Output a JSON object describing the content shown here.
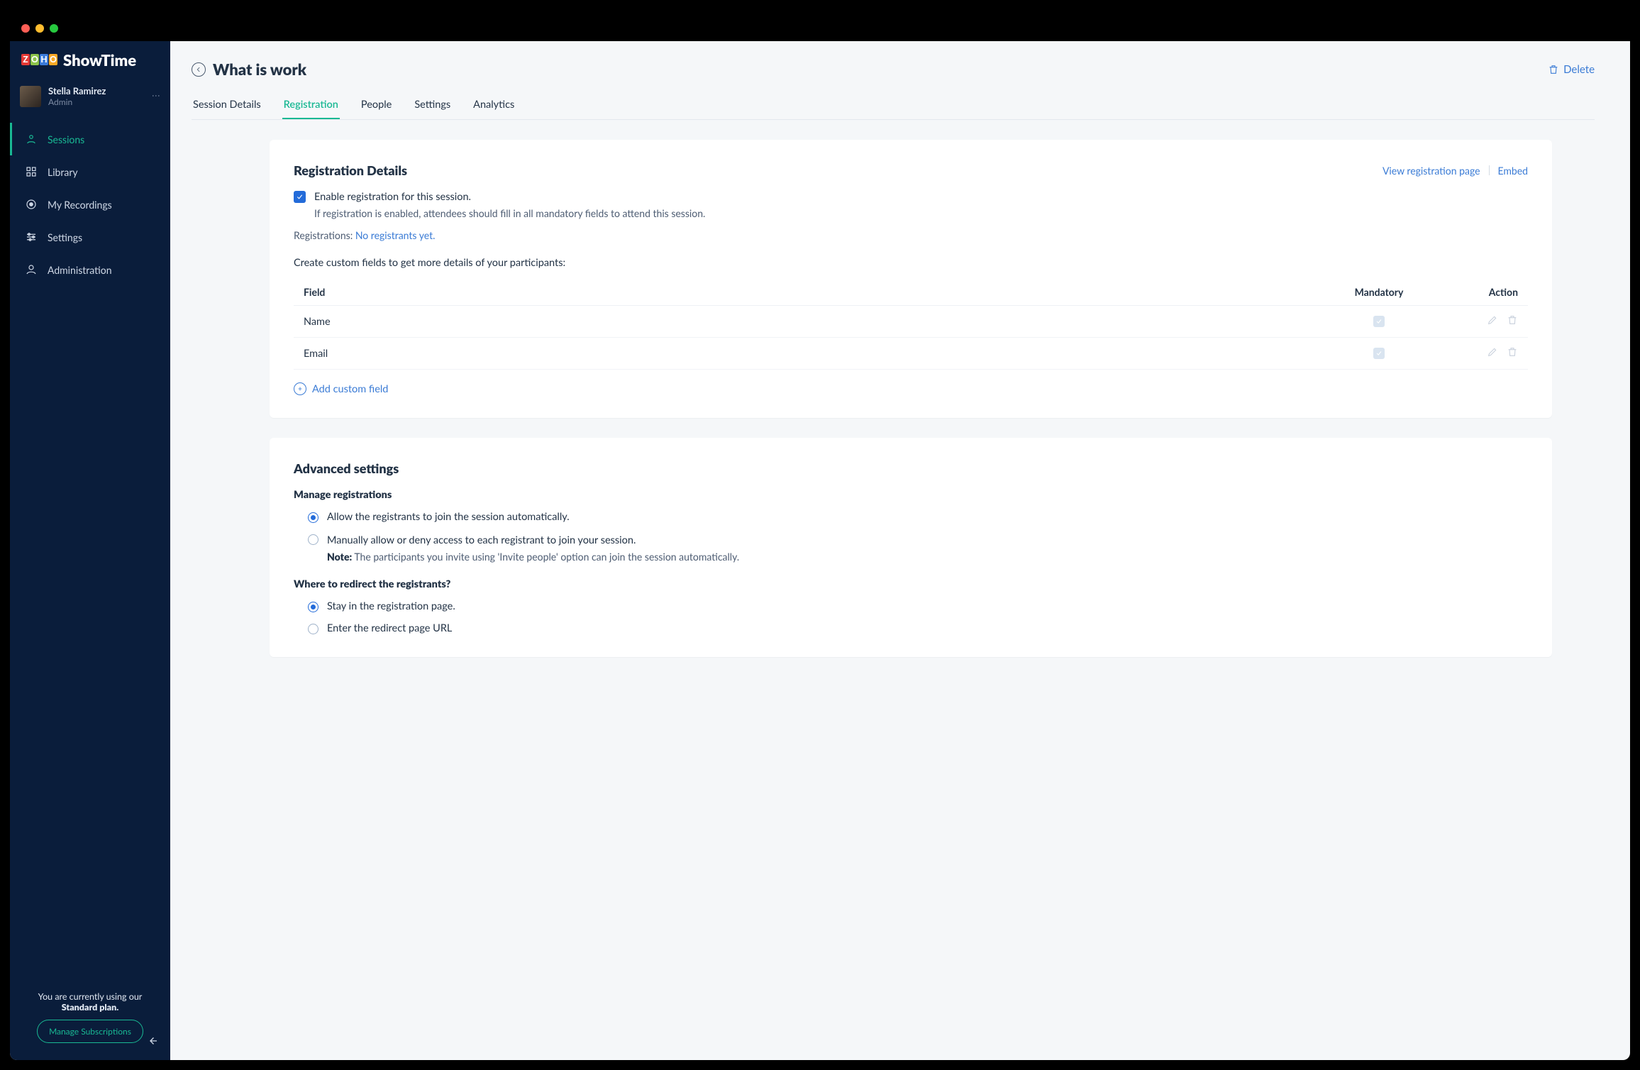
{
  "brand": {
    "name": "ShowTime",
    "logo_letters": [
      "Z",
      "O",
      "H",
      "O"
    ]
  },
  "user": {
    "name": "Stella Ramirez",
    "role": "Admin"
  },
  "nav": {
    "items": [
      {
        "label": "Sessions",
        "icon": "users-icon",
        "active": true
      },
      {
        "label": "Library",
        "icon": "grid-icon",
        "active": false
      },
      {
        "label": "My Recordings",
        "icon": "record-icon",
        "active": false
      },
      {
        "label": "Settings",
        "icon": "sliders-icon",
        "active": false
      },
      {
        "label": "Administration",
        "icon": "person-icon",
        "active": false
      }
    ]
  },
  "plan": {
    "text_prefix": "You are currently using our",
    "plan_name": "Standard plan.",
    "manage_label": "Manage Subscriptions"
  },
  "page": {
    "title": "What is work",
    "delete_label": "Delete",
    "tabs": [
      "Session Details",
      "Registration",
      "People",
      "Settings",
      "Analytics"
    ],
    "active_tab_index": 1
  },
  "registration": {
    "heading": "Registration Details",
    "view_link": "View registration page",
    "embed_link": "Embed",
    "enable_label": "Enable registration for this session.",
    "enable_sub": "If registration is enabled, attendees should fill in all mandatory fields to attend this session.",
    "reg_label": "Registrations: ",
    "reg_status": "No registrants yet.",
    "custom_label": "Create custom fields to get more details of your participants:",
    "columns": [
      "Field",
      "Mandatory",
      "Action"
    ],
    "fields": [
      {
        "name": "Name",
        "mandatory": true
      },
      {
        "name": "Email",
        "mandatory": true
      }
    ],
    "add_label": "Add custom field"
  },
  "advanced": {
    "heading": "Advanced settings",
    "manage_heading": "Manage registrations",
    "manage_options": [
      {
        "label": "Allow the registrants to join the session automatically.",
        "selected": true
      },
      {
        "label": "Manually allow or deny access to each registrant to join your session.",
        "selected": false
      }
    ],
    "note_prefix": "Note:",
    "note_text": " The participants you invite using 'Invite people' option can join the session automatically.",
    "redirect_heading": "Where to redirect the registrants?",
    "redirect_options": [
      {
        "label": "Stay in the registration page.",
        "selected": true
      },
      {
        "label": "Enter the redirect page URL",
        "selected": false
      }
    ]
  }
}
